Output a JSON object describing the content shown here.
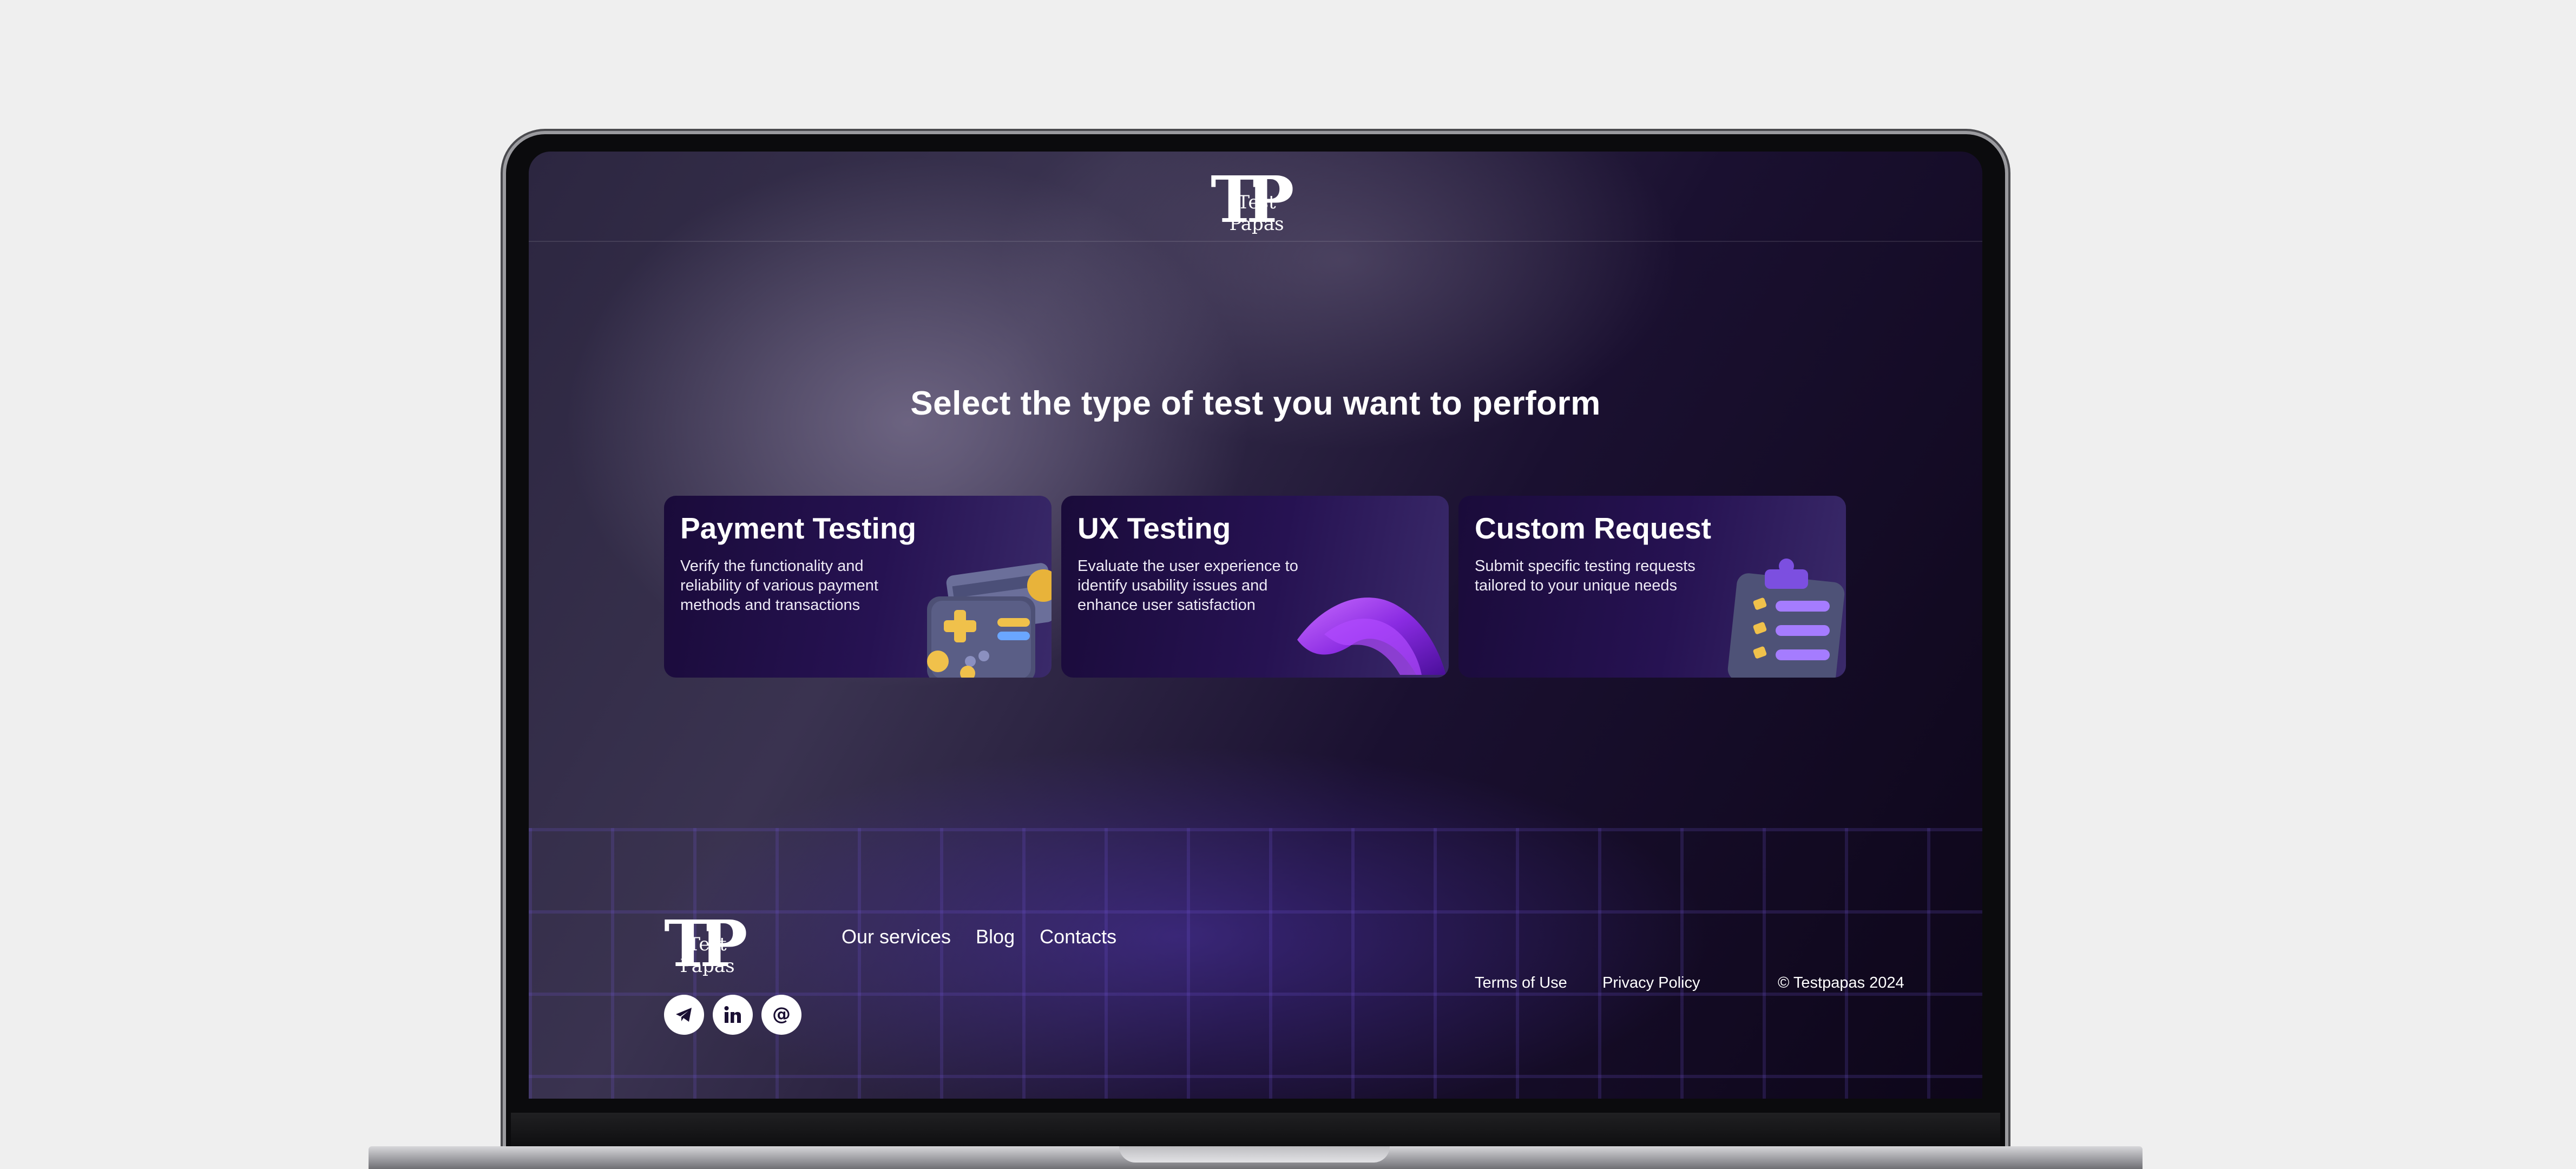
{
  "brand": {
    "monogram": "TP",
    "name": "Test Papas"
  },
  "main": {
    "title": "Select the type of test you want to perform"
  },
  "cards": [
    {
      "title": "Payment Testing",
      "description": "Verify the functionality and reliability of various payment methods and transactions",
      "icon": "payment-card-icon"
    },
    {
      "title": "UX Testing",
      "description": "Evaluate the user experience to identify usability issues and enhance user satisfaction",
      "icon": "abstract-ribbon-icon"
    },
    {
      "title": "Custom Request",
      "description": "Submit specific testing requests tailored to your unique needs",
      "icon": "clipboard-checklist-icon"
    }
  ],
  "footer": {
    "nav": [
      "Our services",
      "Blog",
      "Contacts"
    ],
    "social": [
      "telegram-icon",
      "linkedin-icon",
      "email-at-icon"
    ],
    "terms": "Terms of Use",
    "privacy": "Privacy Policy",
    "copyright": "© Testpapas 2024"
  },
  "colors": {
    "background": "#120a22",
    "card": "#231048",
    "accent": "#7b4ce0",
    "text": "#ffffff"
  }
}
